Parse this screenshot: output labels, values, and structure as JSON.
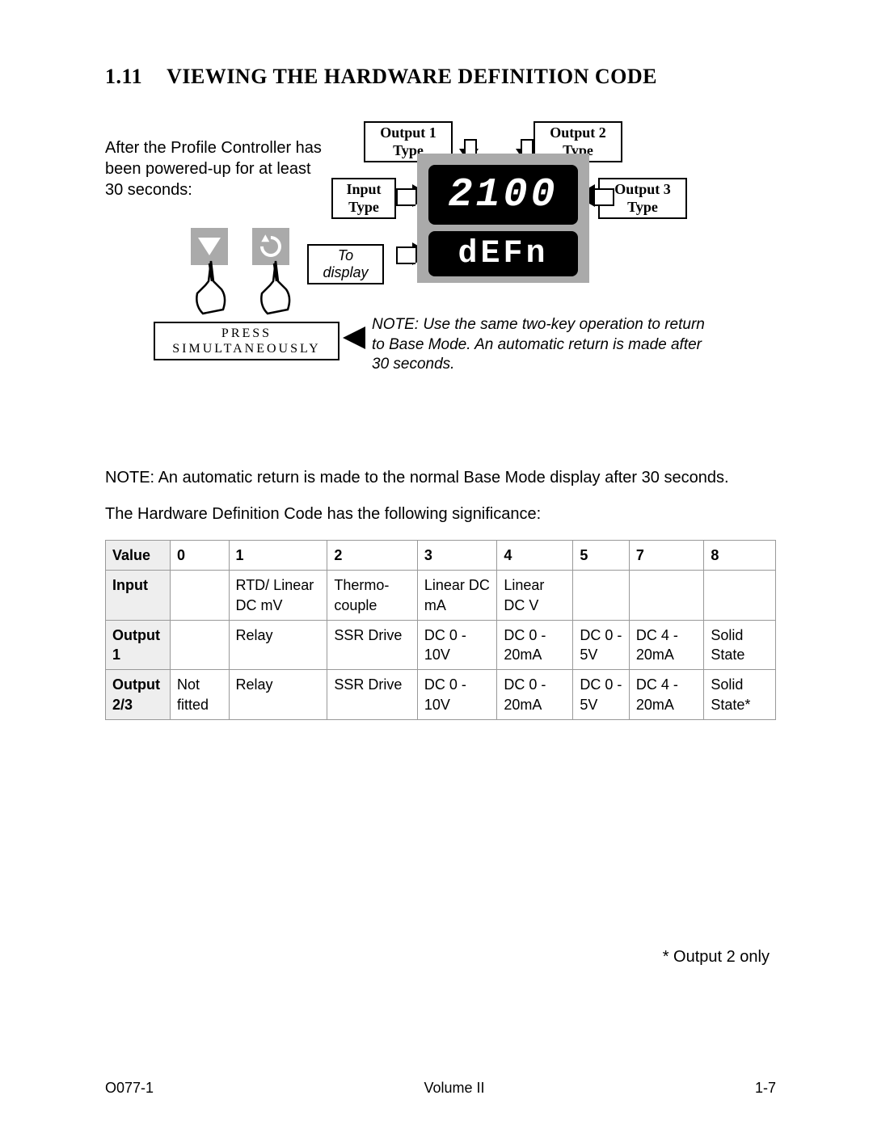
{
  "heading": {
    "num": "1.11",
    "title": "VIEWING THE HARDWARE DEFINITION CODE"
  },
  "intro": "After the Profile Controller has been powered-up for at least 30 seconds:",
  "labels": {
    "out1": "Output 1 Type",
    "out2": "Output 2 Type",
    "out3": "Output 3 Type",
    "input": "Input Type",
    "to_display": "To display",
    "press": "PRESS SIMULTANEOUSLY"
  },
  "display": {
    "top": "2100",
    "bottom": "dEFn"
  },
  "note_inline": "NOTE: Use the same two-key operation to return to Base Mode. An automatic return is made after 30 seconds.",
  "note_body": "NOTE: An automatic return is made to the normal Base Mode display after 30 seconds.",
  "significance": "The Hardware Definition Code has the following significance:",
  "table": {
    "header": [
      "Value",
      "0",
      "1",
      "2",
      "3",
      "4",
      "5",
      "7",
      "8"
    ],
    "rows": [
      {
        "label": "Input",
        "cells": [
          "",
          "RTD/ Linear DC mV",
          "Thermo-couple",
          "Linear DC mA",
          "Linear DC V",
          "",
          "",
          ""
        ]
      },
      {
        "label": "Output 1",
        "cells": [
          "",
          "Relay",
          "SSR Drive",
          "DC 0 - 10V",
          "DC 0 - 20mA",
          "DC 0 - 5V",
          "DC 4 - 20mA",
          "Solid State"
        ]
      },
      {
        "label": "Output 2/3",
        "cells": [
          "Not fitted",
          "Relay",
          "SSR Drive",
          "DC 0 - 10V",
          "DC 0 - 20mA",
          "DC 0 - 5V",
          "DC 4 - 20mA",
          "Solid State*"
        ]
      }
    ]
  },
  "footnote": "* Output 2 only",
  "footer": {
    "left": "O077-1",
    "center": "Volume II",
    "right": "1-7"
  }
}
